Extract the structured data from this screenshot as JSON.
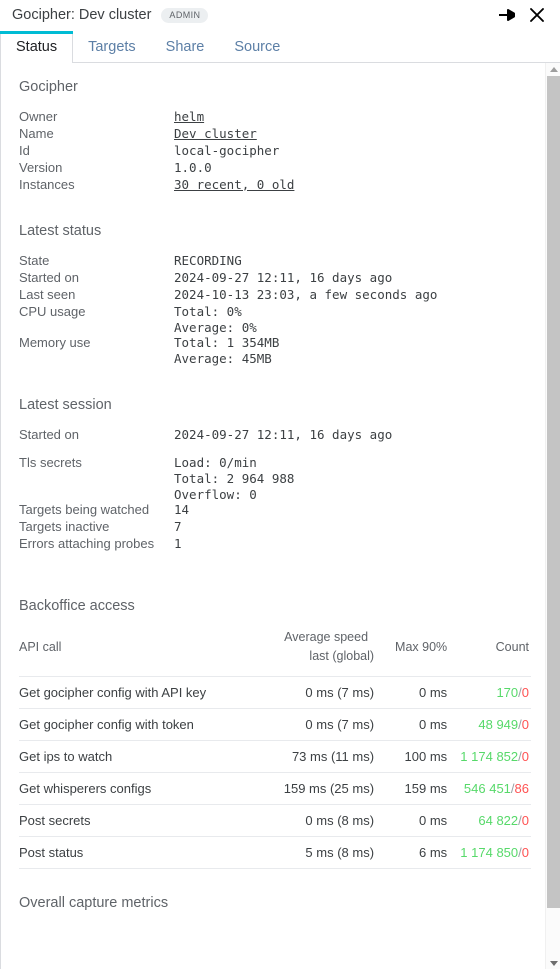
{
  "window": {
    "title": "Gocipher: Dev cluster",
    "badge": "ADMIN",
    "pin_icon": "pin-icon",
    "close_icon": "close-icon"
  },
  "tabs": [
    {
      "label": "Status",
      "active": true
    },
    {
      "label": "Targets",
      "active": false
    },
    {
      "label": "Share",
      "active": false
    },
    {
      "label": "Source",
      "active": false
    }
  ],
  "sections": {
    "gocipher": {
      "title": "Gocipher",
      "rows": [
        {
          "label": "Owner",
          "value": "helm",
          "link": true
        },
        {
          "label": "Name",
          "value": "Dev cluster",
          "link": true
        },
        {
          "label": "Id",
          "value": "local-gocipher",
          "link": false
        },
        {
          "label": "Version",
          "value": "1.0.0",
          "link": false
        },
        {
          "label": "Instances",
          "value": "30 recent, 0 old",
          "link": true
        }
      ]
    },
    "latest_status": {
      "title": "Latest status",
      "rows": [
        {
          "label": "State",
          "value": "RECORDING"
        },
        {
          "label": "Started on",
          "value": "2024-09-27 12:11, 16 days ago"
        },
        {
          "label": "Last seen",
          "value": "2024-10-13 23:03, a few seconds ago"
        },
        {
          "label": "CPU usage",
          "value": "Total: 0%\nAverage: 0%"
        },
        {
          "label": "Memory use",
          "value": "Total: 1 354MB\nAverage: 45MB"
        }
      ]
    },
    "latest_session": {
      "title": "Latest session",
      "rows": [
        {
          "label": "Started on",
          "value": "2024-09-27 12:11, 16 days ago"
        },
        {
          "label": "",
          "value": "",
          "spacer": true
        },
        {
          "label": "Tls secrets",
          "value": "Load: 0/min\nTotal: 2 964 988\nOverflow: 0"
        },
        {
          "label": "Targets being watched",
          "value": "14"
        },
        {
          "label": "Targets inactive",
          "value": "7"
        },
        {
          "label": "Errors attaching probes",
          "value": "1"
        }
      ]
    },
    "backoffice": {
      "title": "Backoffice access",
      "headers": {
        "api_call": "API call",
        "average_speed_line1": "Average speed",
        "average_speed_line2": "last (global)",
        "max90": "Max 90%",
        "count": "Count"
      },
      "rows": [
        {
          "name": "Get gocipher config with API key",
          "avg": "0 ms (7 ms)",
          "max": "0 ms",
          "ok": "170",
          "err": "0"
        },
        {
          "name": "Get gocipher config with token",
          "avg": "0 ms (7 ms)",
          "max": "0 ms",
          "ok": "48 949",
          "err": "0"
        },
        {
          "name": "Get ips to watch",
          "avg": "73 ms (11 ms)",
          "max": "100 ms",
          "ok": "1 174 852",
          "err": "0"
        },
        {
          "name": "Get whisperers configs",
          "avg": "159 ms (25 ms)",
          "max": "159 ms",
          "ok": "546 451",
          "err": "86"
        },
        {
          "name": "Post secrets",
          "avg": "0 ms (8 ms)",
          "max": "0 ms",
          "ok": "64 822",
          "err": "0"
        },
        {
          "name": "Post status",
          "avg": "5 ms (8 ms)",
          "max": "6 ms",
          "ok": "1 174 850",
          "err": "0"
        }
      ],
      "separator": "/"
    },
    "overall": {
      "title": "Overall capture metrics"
    }
  },
  "colors": {
    "accent": "#00bcd4",
    "ok": "#57d96a",
    "error": "#ff5252",
    "label": "#5f6368",
    "value": "#3c4043",
    "tab_inactive": "#5c7fa6"
  },
  "scrollbar": {
    "up_icon": "chevron-up-icon",
    "down_icon": "chevron-down-icon"
  }
}
